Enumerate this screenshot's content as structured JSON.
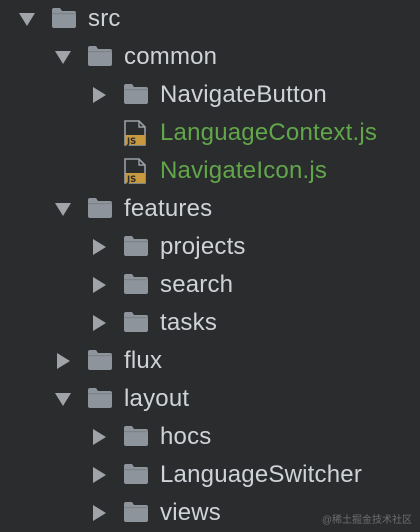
{
  "tree": {
    "rows": [
      {
        "label": "src",
        "type": "folder",
        "state": "expanded",
        "depth": 0
      },
      {
        "label": "common",
        "type": "folder",
        "state": "expanded",
        "depth": 1
      },
      {
        "label": "NavigateButton",
        "type": "folder",
        "state": "collapsed",
        "depth": 2
      },
      {
        "label": "LanguageContext.js",
        "type": "js-file",
        "depth": 2
      },
      {
        "label": "NavigateIcon.js",
        "type": "js-file",
        "depth": 2
      },
      {
        "label": "features",
        "type": "folder",
        "state": "expanded",
        "depth": 1
      },
      {
        "label": "projects",
        "type": "folder",
        "state": "collapsed",
        "depth": 2
      },
      {
        "label": "search",
        "type": "folder",
        "state": "collapsed",
        "depth": 2
      },
      {
        "label": "tasks",
        "type": "folder",
        "state": "collapsed",
        "depth": 2
      },
      {
        "label": "flux",
        "type": "folder",
        "state": "collapsed",
        "depth": 1
      },
      {
        "label": "layout",
        "type": "folder",
        "state": "expanded",
        "depth": 1
      },
      {
        "label": "hocs",
        "type": "folder",
        "state": "collapsed",
        "depth": 2
      },
      {
        "label": "LanguageSwitcher",
        "type": "folder",
        "state": "collapsed",
        "depth": 2
      },
      {
        "label": "views",
        "type": "folder",
        "state": "collapsed",
        "depth": 2
      }
    ],
    "js_badge": "JS"
  },
  "watermark": "@稀土掘金技术社区",
  "colors": {
    "background": "#2b2c2e",
    "text": "#cfd3d8",
    "js_text": "#62a64a",
    "folder": "#8d949b",
    "arrow": "#a0a4a8"
  }
}
